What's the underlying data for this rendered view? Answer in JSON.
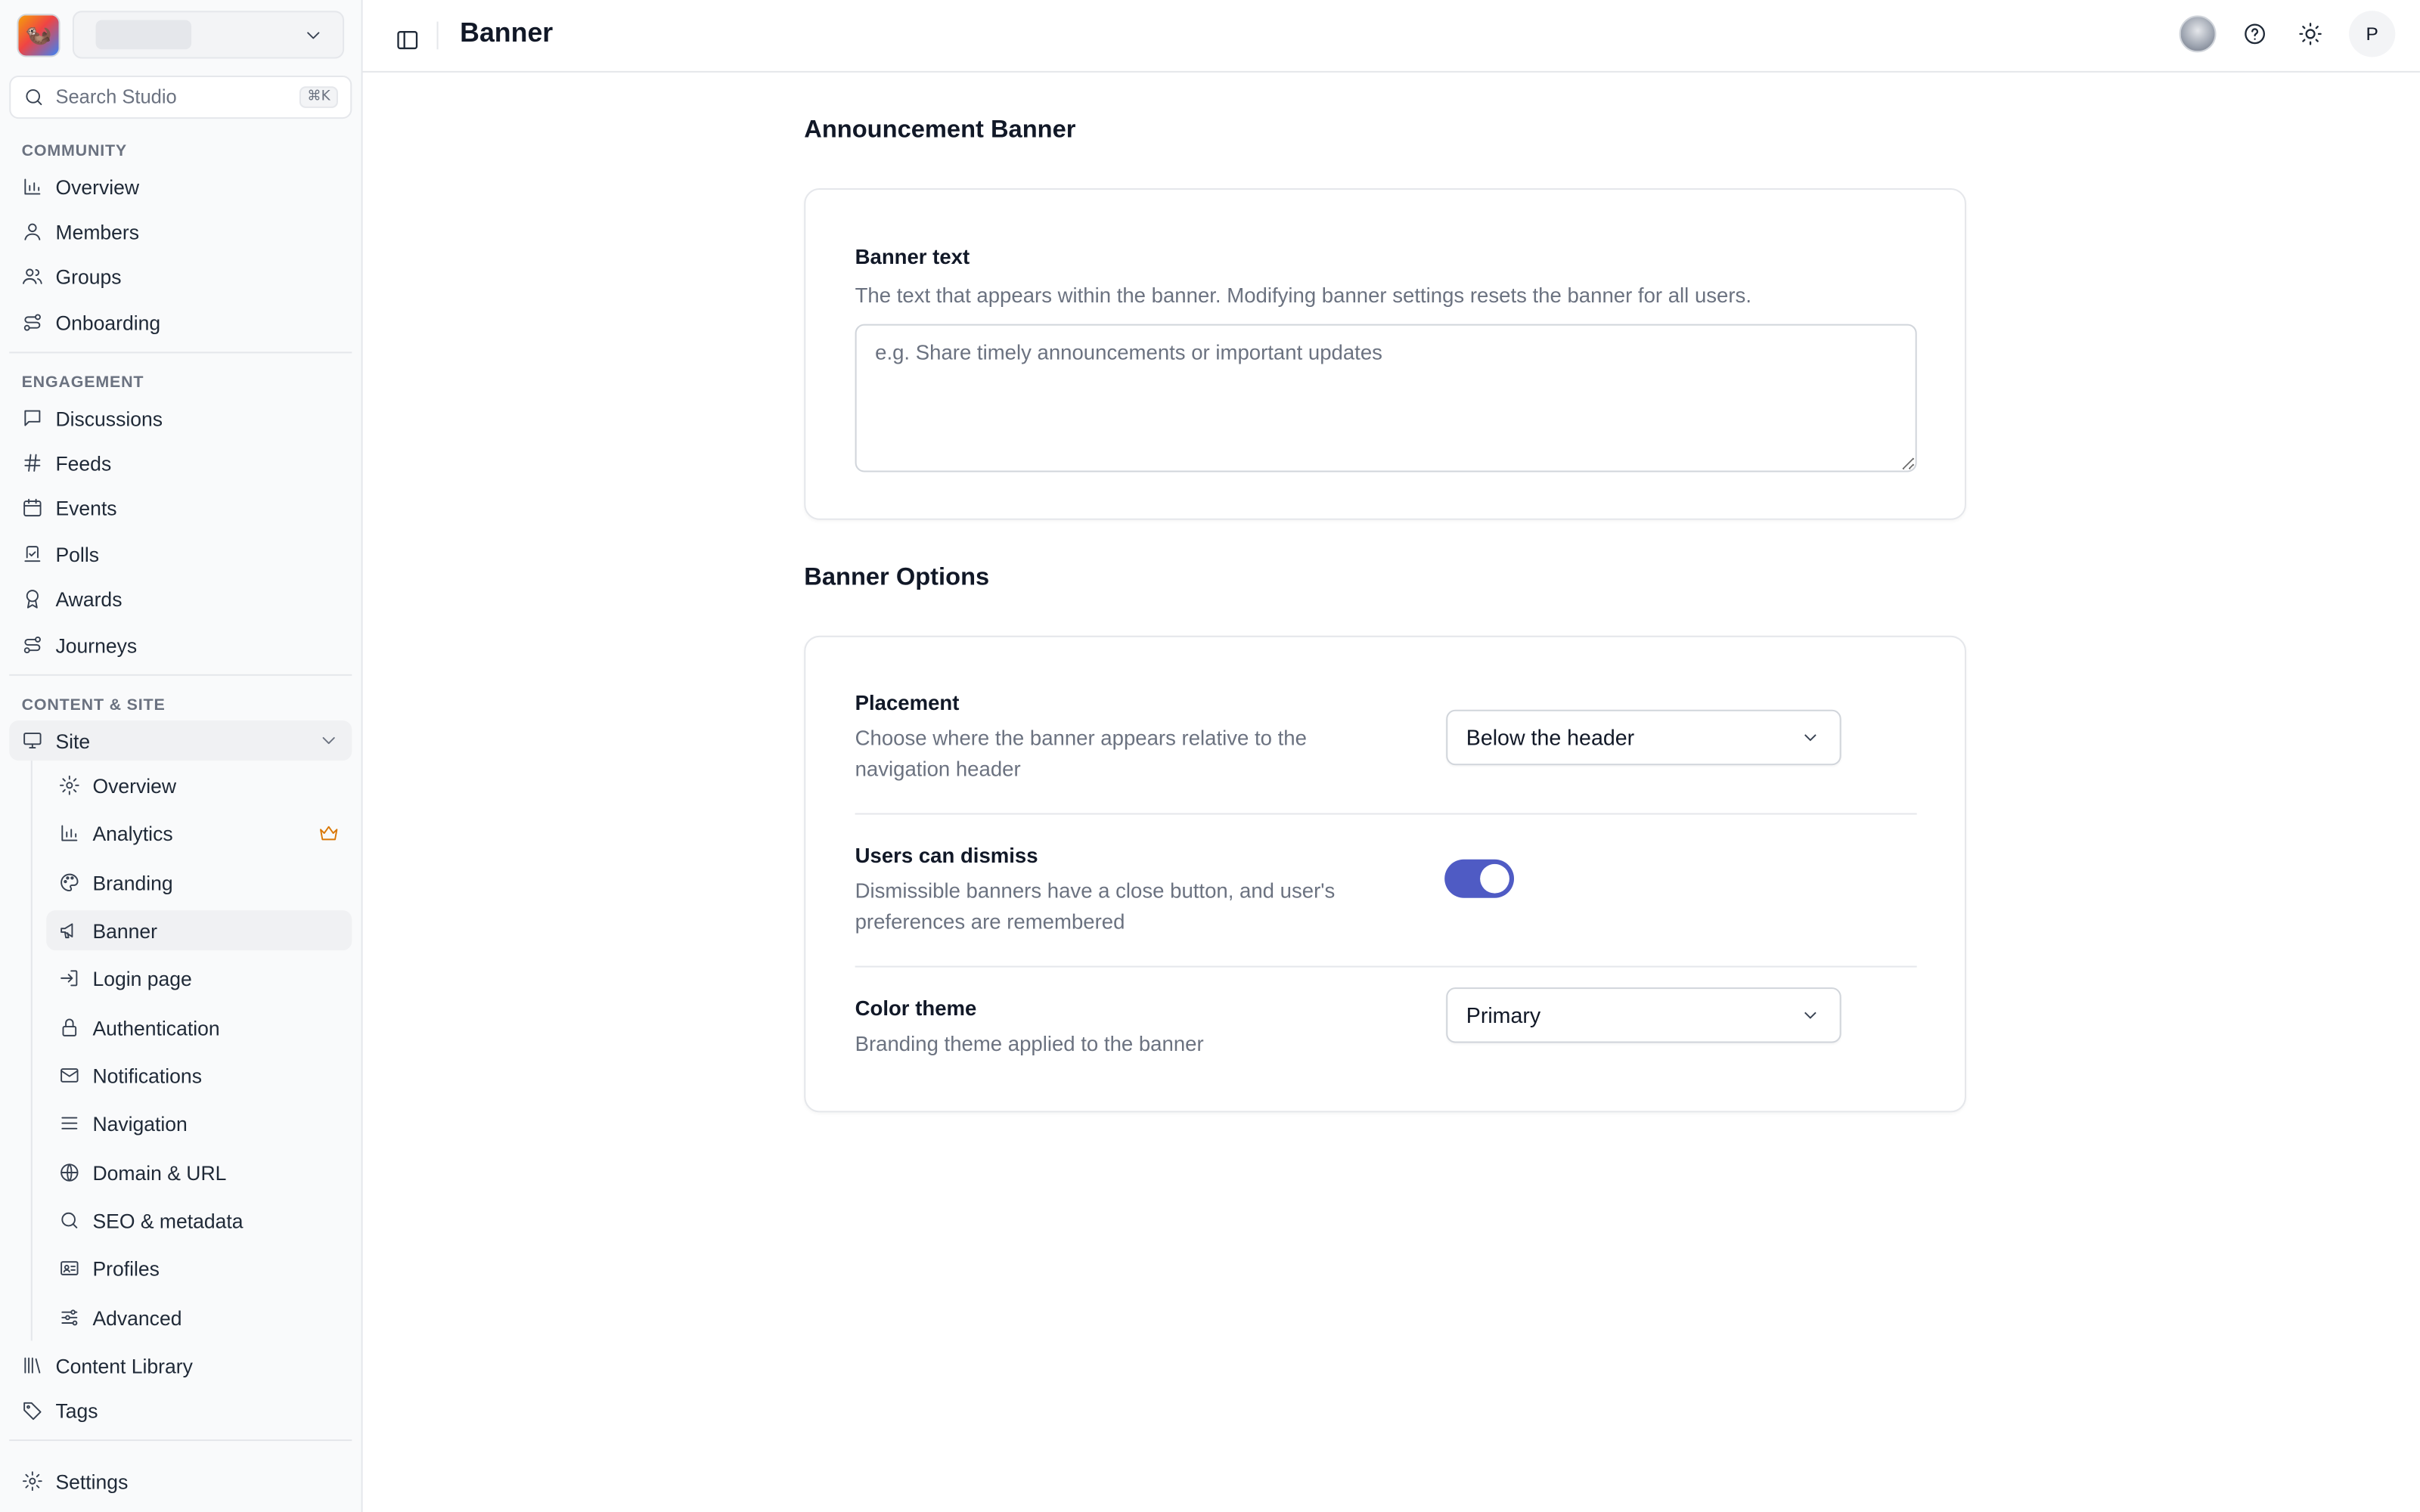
{
  "app": {
    "search_placeholder": "Search Studio",
    "search_shortcut": "⌘K"
  },
  "sidebar": {
    "sections": {
      "community": "COMMUNITY",
      "engagement": "ENGAGEMENT",
      "content_site": "CONTENT & SITE"
    },
    "community_items": [
      "Overview",
      "Members",
      "Groups",
      "Onboarding"
    ],
    "engagement_items": [
      "Discussions",
      "Feeds",
      "Events",
      "Polls",
      "Awards",
      "Journeys"
    ],
    "site_label": "Site",
    "site_items": [
      "Overview",
      "Analytics",
      "Branding",
      "Banner",
      "Login page",
      "Authentication",
      "Notifications",
      "Navigation",
      "Domain & URL",
      "SEO & metadata",
      "Profiles",
      "Advanced"
    ],
    "bottom_items": [
      "Content Library",
      "Tags"
    ],
    "settings_label": "Settings",
    "active_item": "Banner"
  },
  "header": {
    "title": "Banner",
    "avatar_initial": "P"
  },
  "announcement": {
    "heading": "Announcement Banner",
    "banner_text_label": "Banner text",
    "banner_text_desc": "The text that appears within the banner. Modifying banner settings resets the banner for all users.",
    "banner_text_placeholder": "e.g. Share timely announcements or important updates",
    "banner_text_value": ""
  },
  "options": {
    "heading": "Banner Options",
    "placement": {
      "label": "Placement",
      "desc": "Choose where the banner appears relative to the navigation header",
      "value": "Below the header"
    },
    "dismiss": {
      "label": "Users can dismiss",
      "desc": "Dismissible banners have a close button, and user's preferences are remembered",
      "enabled": true
    },
    "color_theme": {
      "label": "Color theme",
      "desc": "Branding theme applied to the banner",
      "value": "Primary"
    }
  },
  "colors": {
    "accent": "#4f5bc4",
    "premium": "#d97706"
  }
}
